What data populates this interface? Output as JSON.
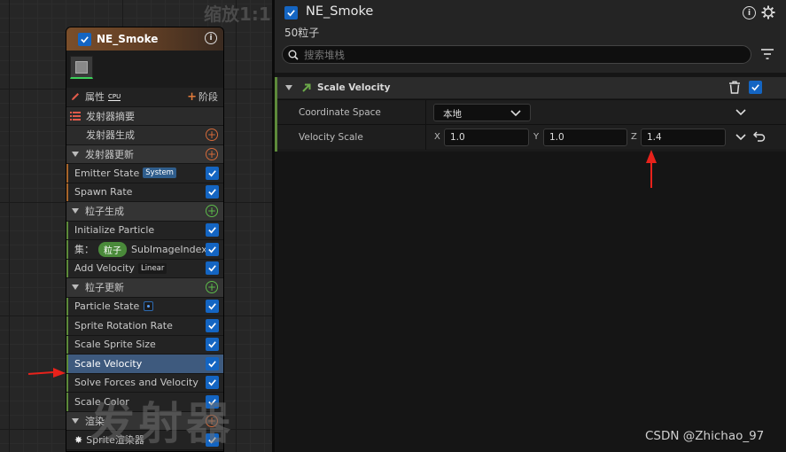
{
  "graph": {
    "zoom_label": "缩放1:1",
    "watermark": "发射器"
  },
  "node": {
    "title": "NE_Smoke",
    "properties_label": "属性",
    "cpu_label": "CPU",
    "stage_button_label": "阶段",
    "summary_label": "发射器摘要",
    "emitter_spawn_label": "发射器生成",
    "emitter_update_label": "发射器更新",
    "emitter_state": {
      "label": "Emitter State",
      "badge": "System"
    },
    "spawn_rate_label": "Spawn Rate",
    "particle_spawn_label": "粒子生成",
    "initialize_particle_label": "Initialize Particle",
    "set_row": {
      "prefix": "集：",
      "pill": "粒子",
      "param": "SubImageIndex"
    },
    "add_velocity": {
      "label": "Add Velocity",
      "badge": "Linear"
    },
    "particle_update_label": "粒子更新",
    "particle_state_label": "Particle State",
    "sprite_rotation_rate_label": "Sprite Rotation Rate",
    "scale_sprite_size_label": "Scale Sprite Size",
    "scale_velocity_label": "Scale Velocity",
    "solve_forces_label": "Solve Forces and Velocity",
    "scale_color_label": "Scale Color",
    "render_label": "渲染",
    "sprite_renderer_label": "Sprite渲染器"
  },
  "details": {
    "title": "NE_Smoke",
    "subtitle": "50粒子",
    "search_placeholder": "搜索堆栈",
    "section_title": "Scale Velocity",
    "coordinate_space": {
      "label": "Coordinate Space",
      "value": "本地"
    },
    "velocity_scale": {
      "label": "Velocity Scale",
      "x_label": "X",
      "x": "1.0",
      "y_label": "Y",
      "y": "1.0",
      "z_label": "Z",
      "z": "1.4"
    }
  },
  "watermark_text": "CSDN @Zhichao_97",
  "colors": {
    "accent_blue": "#1465c2",
    "selected_row": "#3e5a7e",
    "annotation_red": "#e8221b",
    "update_green": "#5dbb4a",
    "spawn_orange": "#d46a3a"
  }
}
